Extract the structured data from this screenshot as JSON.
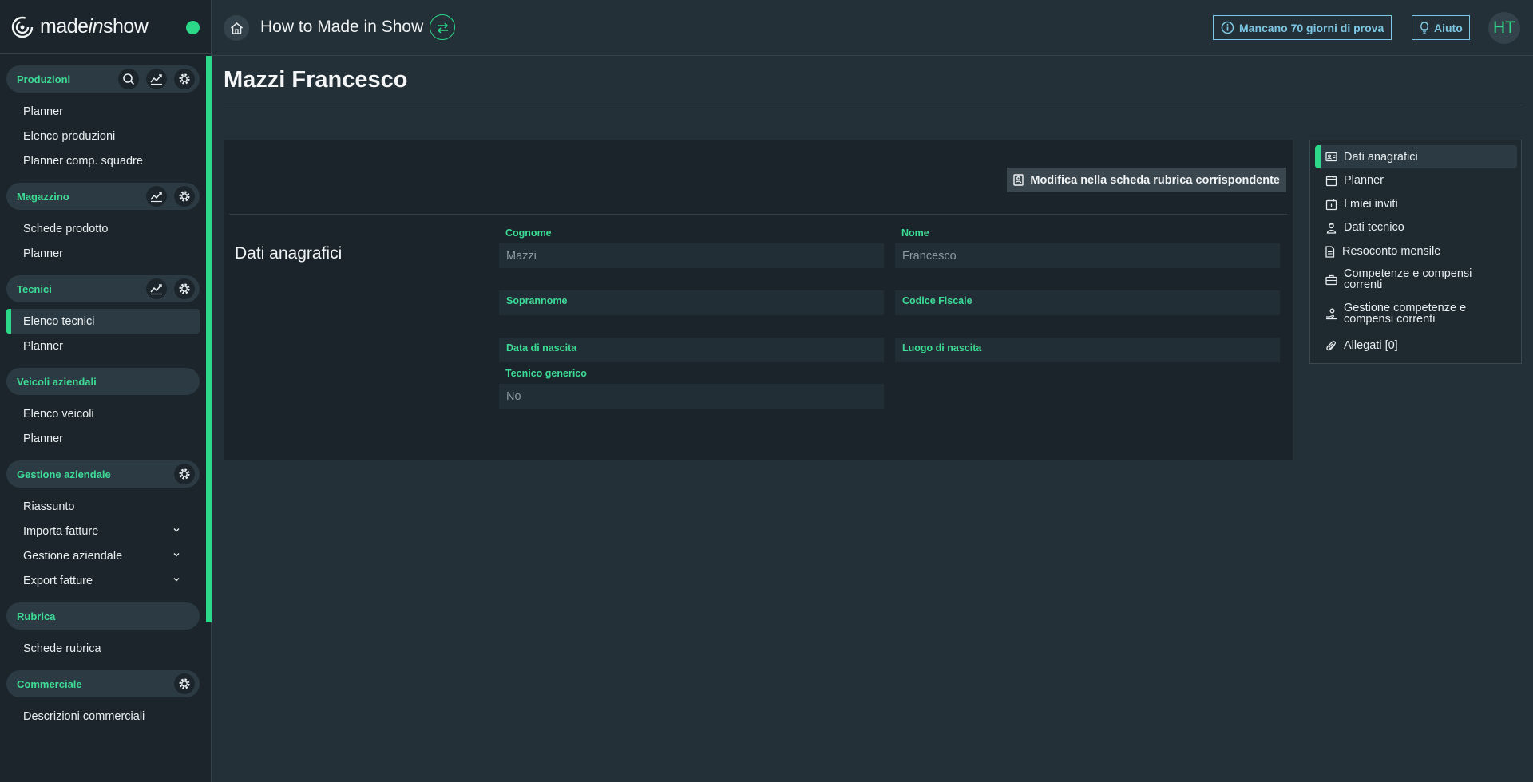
{
  "app": {
    "logo_text_a": "made",
    "logo_text_b": "in",
    "logo_text_c": "show",
    "project_title": "How to Made in Show",
    "trial_label": "Mancano 70 giorni di prova",
    "help_label": "Aiuto",
    "avatar_initials": "HT",
    "accent_color": "#2bd988"
  },
  "sidebar": {
    "sections": [
      {
        "title": "Produzioni",
        "items": [
          "Planner",
          "Elenco produzioni",
          "Planner comp. squadre"
        ]
      },
      {
        "title": "Magazzino",
        "items": [
          "Schede prodotto",
          "Planner"
        ]
      },
      {
        "title": "Tecnici",
        "items": [
          "Elenco tecnici",
          "Planner"
        ],
        "active_item": "Elenco tecnici"
      },
      {
        "title": "Veicoli aziendali",
        "items": [
          "Elenco veicoli",
          "Planner"
        ]
      },
      {
        "title": "Gestione aziendale",
        "items": [
          "Riassunto",
          "Importa fatture",
          "Gestione aziendale",
          "Export fatture"
        ]
      },
      {
        "title": "Rubrica",
        "items": [
          "Schede rubrica"
        ]
      },
      {
        "title": "Commerciale",
        "items": [
          "Descrizioni commerciali"
        ]
      }
    ]
  },
  "main": {
    "page_title": "Mazzi Francesco",
    "edit_button": "Modifica nella scheda rubrica corrispondente",
    "section_title": "Dati anagrafici",
    "fields": {
      "cognome_label": "Cognome",
      "cognome_value": "Mazzi",
      "nome_label": "Nome",
      "nome_value": "Francesco",
      "soprannome_label": "Soprannome",
      "codice_fiscale_label": "Codice Fiscale",
      "data_nascita_label": "Data di nascita",
      "luogo_nascita_label": "Luogo di nascita",
      "tecnico_generico_label": "Tecnico generico",
      "tecnico_generico_value": "No"
    }
  },
  "side_tabs": {
    "items": [
      "Dati anagrafici",
      "Planner",
      "I miei inviti",
      "Dati tecnico",
      "Resoconto mensile",
      "Competenze e compensi",
      "correnti",
      "Gestione competenze e",
      "compensi correnti",
      "Allegati [0]"
    ],
    "active": "Dati anagrafici"
  }
}
